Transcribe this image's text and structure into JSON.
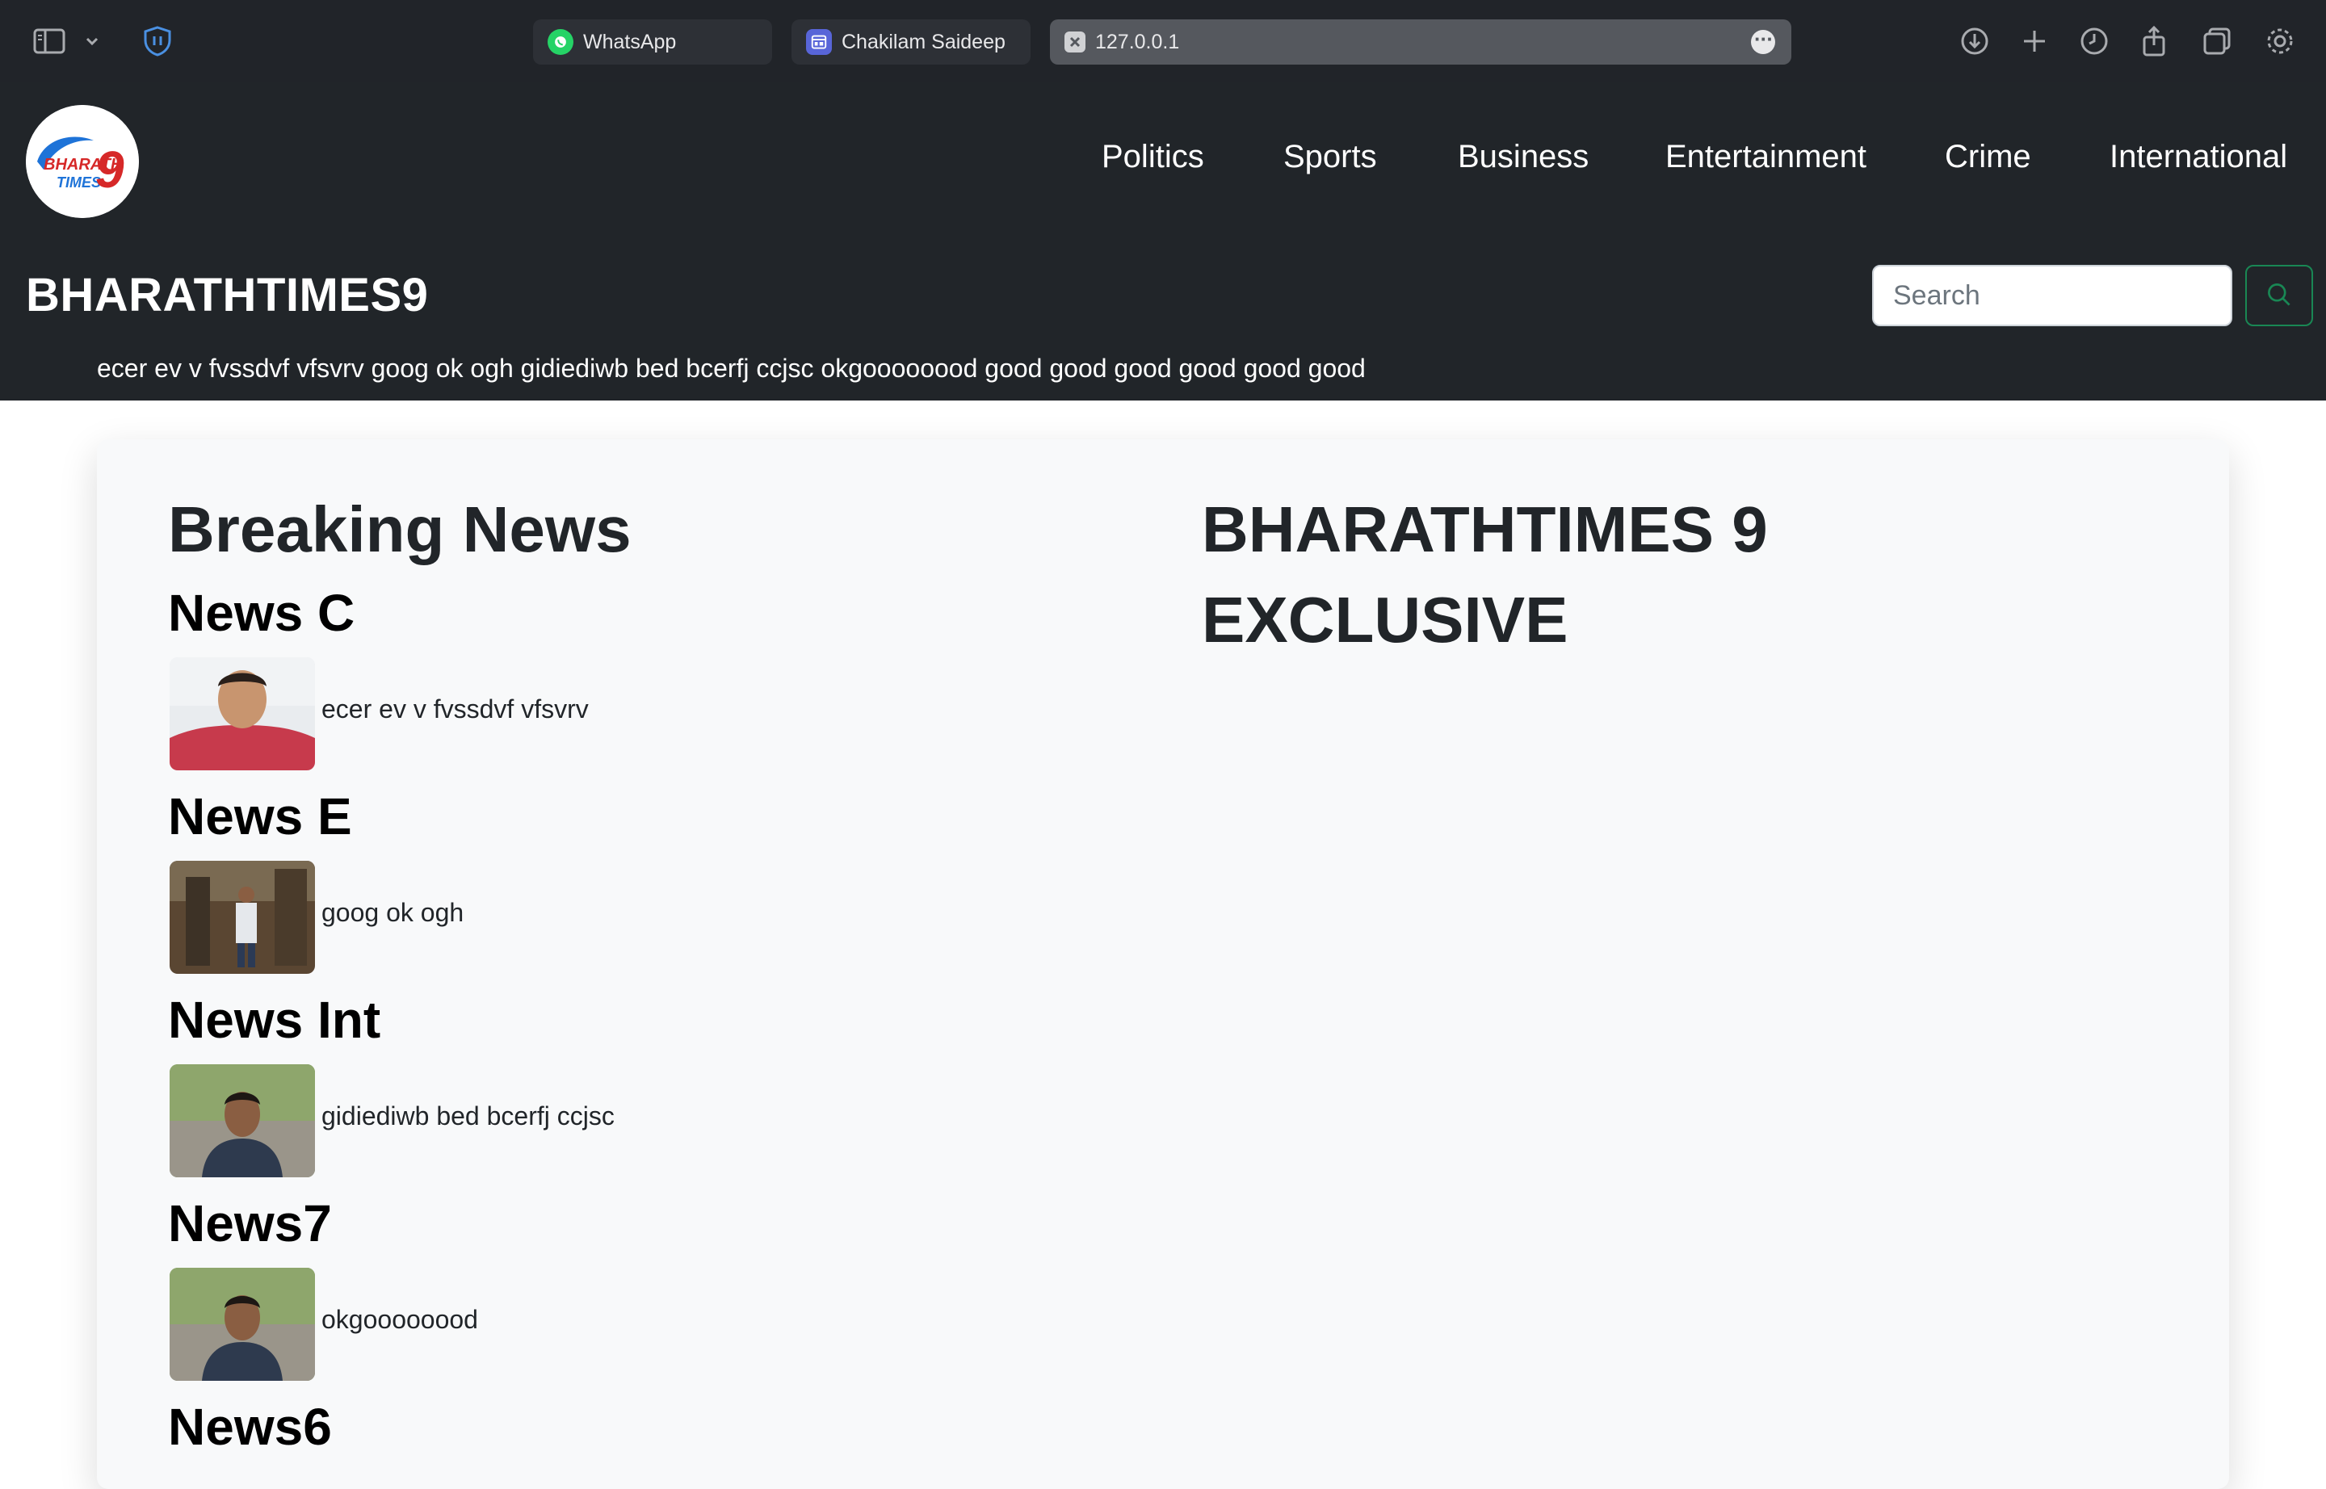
{
  "browser": {
    "tabs": [
      {
        "label": "WhatsApp",
        "icon": "whatsapp-icon"
      },
      {
        "label": "Chakilam Saideep",
        "icon": "app-grid-icon"
      },
      {
        "label": "127.0.0.1",
        "icon": "close-icon"
      }
    ],
    "toolbar_icons": [
      "sidebar-icon",
      "chevron-down-icon",
      "shield-icon",
      "download-icon",
      "new-tab-icon",
      "history-icon",
      "share-icon",
      "tabs-overview-icon",
      "settings-icon"
    ]
  },
  "header": {
    "logo_text": "BHARATH TIMES 9",
    "nav": [
      "Politics",
      "Sports",
      "Business",
      "Entertainment",
      "Crime",
      "International"
    ],
    "brand": "BHARATHTIMES9",
    "search": {
      "placeholder": "Search"
    },
    "ticker": "ecer ev v fvssdvf vfsvrv goog ok ogh gidiediwb bed bcerfj ccjsc okgoooooood good good good good good good"
  },
  "main": {
    "breaking_heading": "Breaking News",
    "right_heading": "BHARATHTIMES 9",
    "right_subheading": "EXCLUSIVE",
    "news": [
      {
        "title": "News C",
        "description": "ecer ev v fvssdvf vfsvrv"
      },
      {
        "title": "News E",
        "description": "goog ok ogh"
      },
      {
        "title": "News Int",
        "description": "gidiediwb bed bcerfj ccjsc"
      },
      {
        "title": "News7",
        "description": "okgoooooood"
      },
      {
        "title": "News6",
        "description": ""
      }
    ]
  },
  "colors": {
    "header_bg": "#212529",
    "card_bg": "#f8f9fa",
    "search_button_border": "#198754"
  }
}
